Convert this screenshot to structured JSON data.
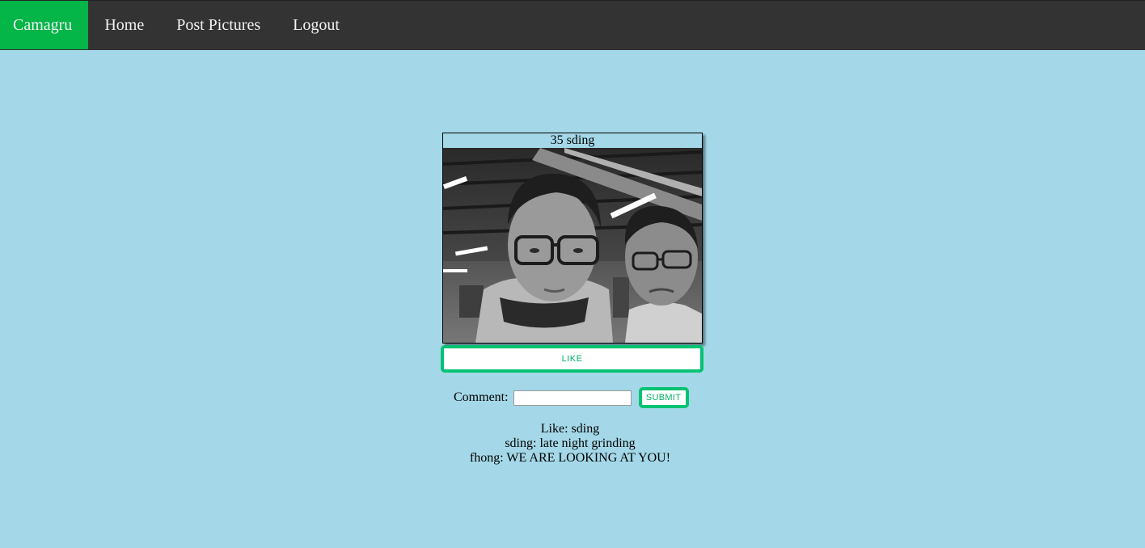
{
  "nav": {
    "brand": "Camagru",
    "items": [
      {
        "label": "Home"
      },
      {
        "label": "Post Pictures"
      },
      {
        "label": "Logout"
      }
    ]
  },
  "post": {
    "caption": "35 sding",
    "like_label": "LIKE"
  },
  "comment_form": {
    "label": "Comment:",
    "input_value": "",
    "submit_label": "SUBMIT"
  },
  "activity": {
    "like_line": "Like: sding",
    "comments": [
      {
        "text": "sding: late night grinding"
      },
      {
        "text": "fhong: WE ARE LOOKING AT YOU!"
      }
    ]
  },
  "colors": {
    "page_background": "#a4d8e8",
    "nav_background": "#333333",
    "brand_background": "#04b548",
    "button_border": "#04c272"
  }
}
